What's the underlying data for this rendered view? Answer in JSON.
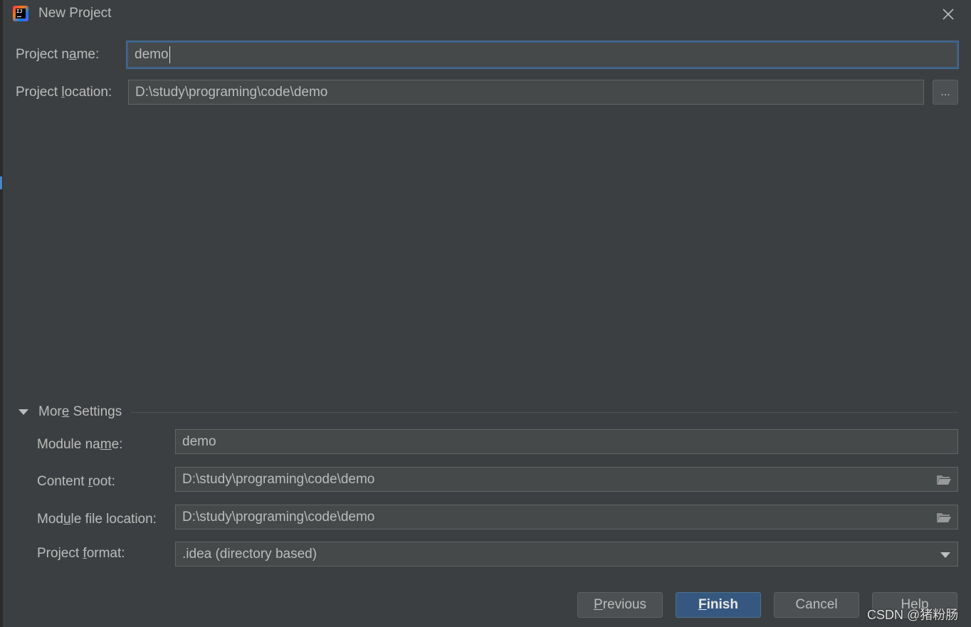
{
  "window": {
    "title": "New Project",
    "app_icon_text": "IJ"
  },
  "project": {
    "name_label_pre": "Project n",
    "name_label_mnemonic": "a",
    "name_label_post": "me:",
    "name_value": "demo",
    "location_label_pre": "Project ",
    "location_label_mnemonic": "l",
    "location_label_post": "ocation:",
    "location_value": "D:\\study\\programing\\code\\demo",
    "browse_label": "..."
  },
  "more_settings": {
    "label_pre": "Mor",
    "label_mnemonic": "e",
    "label_post": " Settings",
    "module_name_label_pre": "Module na",
    "module_name_label_mnemonic": "m",
    "module_name_label_post": "e:",
    "module_name_value": "demo",
    "content_root_label_pre": "Content ",
    "content_root_label_mnemonic": "r",
    "content_root_label_post": "oot:",
    "content_root_value": "D:\\study\\programing\\code\\demo",
    "module_file_label_pre": "Mod",
    "module_file_label_mnemonic": "u",
    "module_file_label_post": "le file location:",
    "module_file_value": "D:\\study\\programing\\code\\demo",
    "project_format_label_pre": "Project ",
    "project_format_label_mnemonic": "f",
    "project_format_label_post": "ormat:",
    "project_format_value": ".idea (directory based)"
  },
  "buttons": {
    "previous_mnemonic": "P",
    "previous_rest": "revious",
    "finish_mnemonic": "F",
    "finish_rest": "inish",
    "cancel": "Cancel",
    "help": "Help"
  },
  "watermark": "CSDN @猪粉肠",
  "colors": {
    "background": "#3c3f41",
    "field": "#45494a",
    "focus_border": "#3d6185",
    "primary_button": "#365880",
    "text": "#bbbbbb"
  }
}
